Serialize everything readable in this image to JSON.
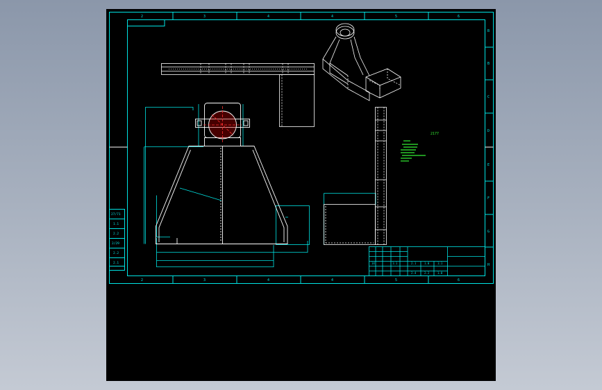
{
  "colors": {
    "frame": "#00e5e5",
    "geometry": "#ffffff",
    "centerline": "#ff3030",
    "annotation": "#33ee33",
    "background": "#000000",
    "page_background": "#9aa4b4"
  },
  "drawing": {
    "top_zone_labels": [
      "2",
      "3",
      "4",
      "4",
      "5",
      "6"
    ],
    "bottom_zone_labels": [
      "2",
      "3",
      "4",
      "4",
      "5",
      "6"
    ],
    "right_zone_labels": [
      "B",
      "B",
      "C",
      "D",
      "E",
      "F",
      "G",
      "H"
    ],
    "left_table_cells": [
      "27/71",
      "1.1",
      "2.2",
      "2/29",
      "2.2",
      "2.1"
    ],
    "green_annotation_title": "2177",
    "title_block_cells": [
      "14",
      "1:1",
      "2.1",
      "1.0",
      "1:1",
      "2.4",
      "2.2",
      "1.8"
    ]
  }
}
